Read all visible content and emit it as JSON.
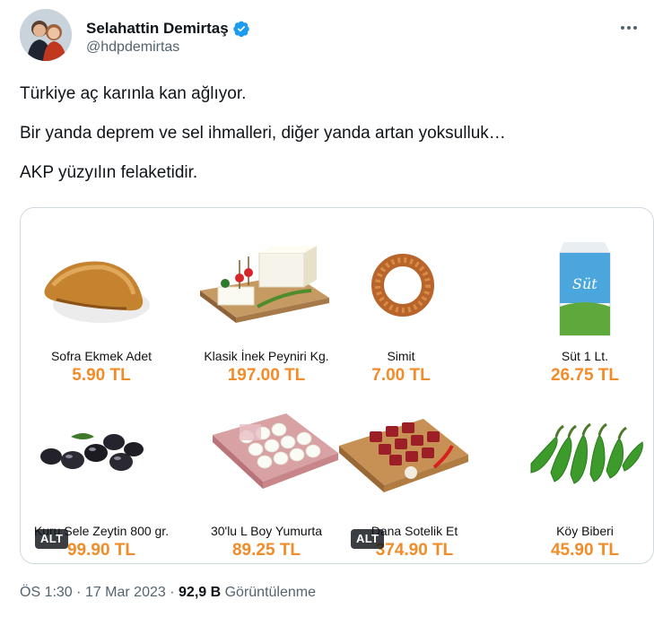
{
  "user": {
    "name": "Selahattin Demirtaş",
    "handle": "@hdpdemirtas"
  },
  "tweet": {
    "lines": [
      "Türkiye aç karınla kan ağlıyor.",
      "Bir yanda deprem ve sel ihmalleri, diğer yanda artan yoksulluk…",
      "AKP yüzyılın felaketidir."
    ]
  },
  "products": [
    {
      "label": "Sofra Ekmek Adet",
      "price": "5.90 TL"
    },
    {
      "label": "Klasik İnek Peyniri Kg.",
      "price": "197.00 TL"
    },
    {
      "label": "Simit",
      "price": "7.00 TL"
    },
    {
      "label": "Süt 1 Lt.",
      "price": "26.75 TL"
    },
    {
      "label": "Kuru Sele Zeytin 800 gr.",
      "price": "99.90 TL"
    },
    {
      "label": "30'lu L Boy Yumurta",
      "price": "89.25 TL"
    },
    {
      "label": "Dana Sotelik Et",
      "price": "374.90 TL"
    },
    {
      "label": "Köy Biberi",
      "price": "45.90 TL"
    }
  ],
  "alt_badge": "ALT",
  "milk_brand": "Süt",
  "meta": {
    "time": "ÖS 1:30",
    "date": "17 Mar 2023",
    "views_count": "92,9 B",
    "views_label": "Görüntülenme"
  },
  "colors": {
    "price": "#f28c28",
    "verified": "#1d9bf0"
  },
  "icons": [
    "verified-badge-icon",
    "more-options-icon"
  ]
}
